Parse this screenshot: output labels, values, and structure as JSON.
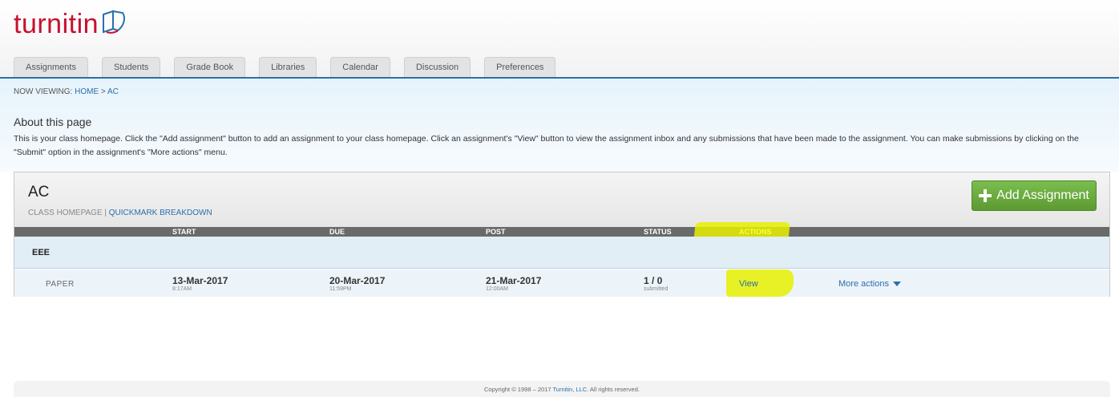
{
  "brand": {
    "logo_text": "turnitin",
    "logo_color": "#c8102e"
  },
  "tabs": [
    {
      "label": "Assignments"
    },
    {
      "label": "Students"
    },
    {
      "label": "Grade Book"
    },
    {
      "label": "Libraries"
    },
    {
      "label": "Calendar"
    },
    {
      "label": "Discussion"
    },
    {
      "label": "Preferences"
    }
  ],
  "breadcrumb": {
    "prefix": "NOW VIEWING: ",
    "home": "HOME",
    "sep": " > ",
    "current": "AC"
  },
  "about": {
    "title": "About this page",
    "text": "This is your class homepage. Click the \"Add assignment\" button to add an assignment to your class homepage. Click an assignment's \"View\" button to view the assignment inbox and any submissions that have been made to the assignment. You can make submissions by clicking on the \"Submit\" option in the assignment's \"More actions\" menu."
  },
  "class": {
    "name": "AC",
    "homepage_label": "CLASS HOMEPAGE",
    "link_sep": " | ",
    "quickmark_label": "QUICKMARK BREAKDOWN",
    "add_button_label": "Add Assignment"
  },
  "columns": {
    "start": "START",
    "due": "DUE",
    "post": "POST",
    "status": "STATUS",
    "actions": "ACTIONS"
  },
  "group": {
    "name": "EEE"
  },
  "assignment": {
    "title": "PAPER",
    "start_date": "13-Mar-2017",
    "start_time": "8:17AM",
    "due_date": "20-Mar-2017",
    "due_time": "11:59PM",
    "post_date": "21-Mar-2017",
    "post_time": "12:00AM",
    "status_count": "1 / 0",
    "status_label": "submitted",
    "view_label": "View",
    "more_actions_label": "More actions"
  },
  "footer": {
    "prefix": "Copyright © 1998 – 2017 ",
    "company": "Turnitin, LLC",
    "suffix": ". All rights reserved."
  },
  "colors": {
    "accent_blue": "#2a6fad",
    "add_green": "#6aab3f",
    "highlight": "#e6f000"
  }
}
